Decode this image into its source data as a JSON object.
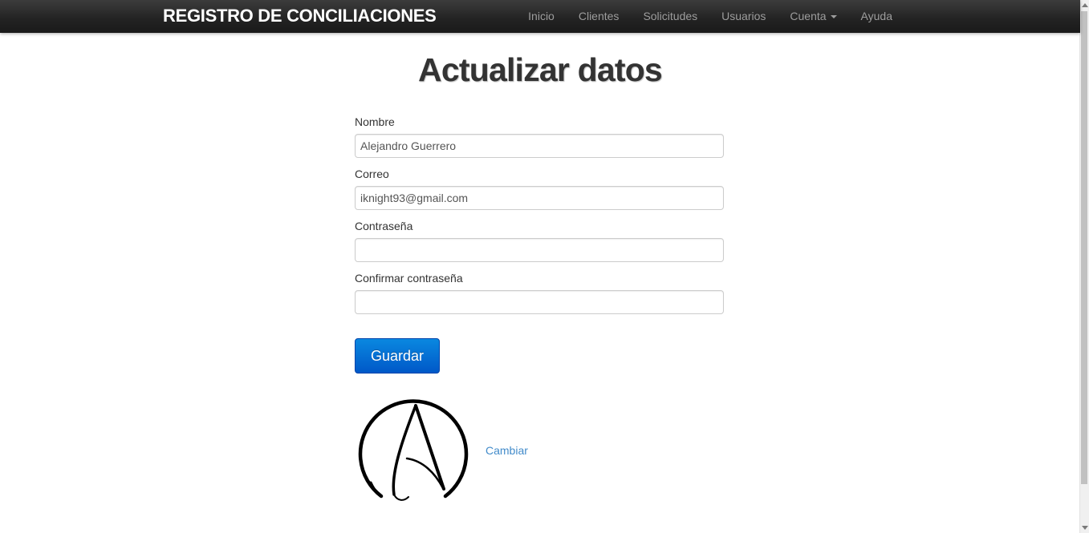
{
  "navbar": {
    "brand": "REGISTRO DE CONCILIACIONES",
    "items": [
      {
        "label": "Inicio"
      },
      {
        "label": "Clientes"
      },
      {
        "label": "Solicitudes"
      },
      {
        "label": "Usuarios"
      },
      {
        "label": "Cuenta"
      },
      {
        "label": "Ayuda"
      }
    ]
  },
  "main": {
    "title": "Actualizar datos",
    "fields": {
      "name": {
        "label": "Nombre",
        "value": "Alejandro Guerrero"
      },
      "email": {
        "label": "Correo",
        "value": "iknight93@gmail.com"
      },
      "password": {
        "label": "Contraseña",
        "value": ""
      },
      "confirm_password": {
        "label": "Confirmar contraseña",
        "value": ""
      }
    },
    "save_label": "Guardar",
    "avatar_icon": "anarchy-symbol-icon",
    "change_link": "Cambiar"
  },
  "colors": {
    "navbar_bg": "#222222",
    "nav_text": "#9d9d9d",
    "primary_button": "#0068d4",
    "link": "#428bca"
  }
}
